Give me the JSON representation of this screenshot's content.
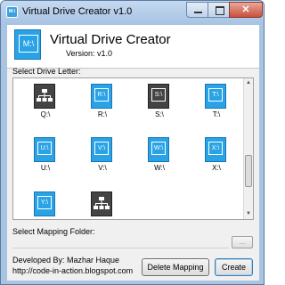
{
  "window": {
    "title": "Virtual Drive Creator v1.0",
    "icon_label": "M:\\"
  },
  "header": {
    "logo_label": "M:\\",
    "app_title": "Virtual Drive Creator",
    "version": "Version:  v1.0"
  },
  "drive_section": {
    "label": "Select Drive Letter:",
    "items": [
      {
        "letter": "Q:\\",
        "icon": "network-drive-icon",
        "caption": "Q:\\"
      },
      {
        "letter": "R:\\",
        "icon": "drive-icon",
        "caption": "R:\\"
      },
      {
        "letter": "S:\\",
        "icon": "drive-used-icon",
        "caption": "S:\\"
      },
      {
        "letter": "T:\\",
        "icon": "drive-icon",
        "caption": "T:\\"
      },
      {
        "letter": "U:\\",
        "icon": "drive-icon",
        "caption": "U:\\"
      },
      {
        "letter": "V:\\",
        "icon": "drive-icon",
        "caption": "V:\\"
      },
      {
        "letter": "W:\\",
        "icon": "drive-icon",
        "caption": "W:\\"
      },
      {
        "letter": "X:\\",
        "icon": "drive-icon",
        "caption": "X:\\"
      },
      {
        "letter": "Y:\\",
        "icon": "drive-icon",
        "caption": ""
      },
      {
        "letter": "",
        "icon": "network-drive-icon",
        "caption": ""
      }
    ]
  },
  "folder_section": {
    "label": "Select Mapping Folder:",
    "value": "",
    "browse_label": "..."
  },
  "footer": {
    "developer": "Developed By: Mazhar Haque",
    "url": "http://code-in-action.blogspot.com",
    "delete_label": "Delete Mapping",
    "create_label": "Create"
  },
  "colors": {
    "accent": "#29a3e6",
    "used_drive": "#444444"
  }
}
